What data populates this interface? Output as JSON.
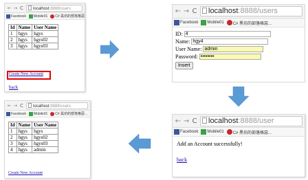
{
  "browser": {
    "url_host": "localhost",
    "url_path": ":8888/users",
    "url_path_short": ":8888/user",
    "bookmarks": [
      {
        "label": "Facebook",
        "icon": "facebook-icon"
      },
      {
        "label": "Mobile01",
        "icon": "mobile01-icon"
      },
      {
        "label": "C# 黑坊的部落格惡...",
        "icon": "csharp-blog-icon"
      }
    ]
  },
  "list_before": {
    "headers": [
      "Id",
      "Name",
      "User Name"
    ],
    "rows": [
      [
        "1",
        "hgys",
        "hgys"
      ],
      [
        "2",
        "hgys",
        "hgys02"
      ],
      [
        "3",
        "hgys",
        "hgys03"
      ]
    ],
    "create_link": "Create New Account",
    "back_link": "back"
  },
  "form": {
    "id_label": "ID:",
    "id_value": "4",
    "name_label": "Name:",
    "name_value": "hgy4",
    "username_label": "User Name:",
    "username_value": "admin",
    "password_label": "Password:",
    "password_value": "••••••••",
    "submit_label": "Insert"
  },
  "result": {
    "message": "Add an Account successfully!",
    "back_link": "back"
  },
  "list_after": {
    "headers": [
      "Id",
      "Name",
      "User Name"
    ],
    "rows": [
      [
        "1",
        "hgys",
        "hgys"
      ],
      [
        "2",
        "hgys",
        "hgys02"
      ],
      [
        "3",
        "hgys",
        "hgys03"
      ],
      [
        "4",
        "hgys",
        "admin"
      ]
    ],
    "create_link": "Create New Account"
  },
  "colors": {
    "arrow": "#5b9bd5",
    "link": "#1a0dab",
    "highlight_box": "#e00000",
    "input_autofill": "#fafab0"
  }
}
